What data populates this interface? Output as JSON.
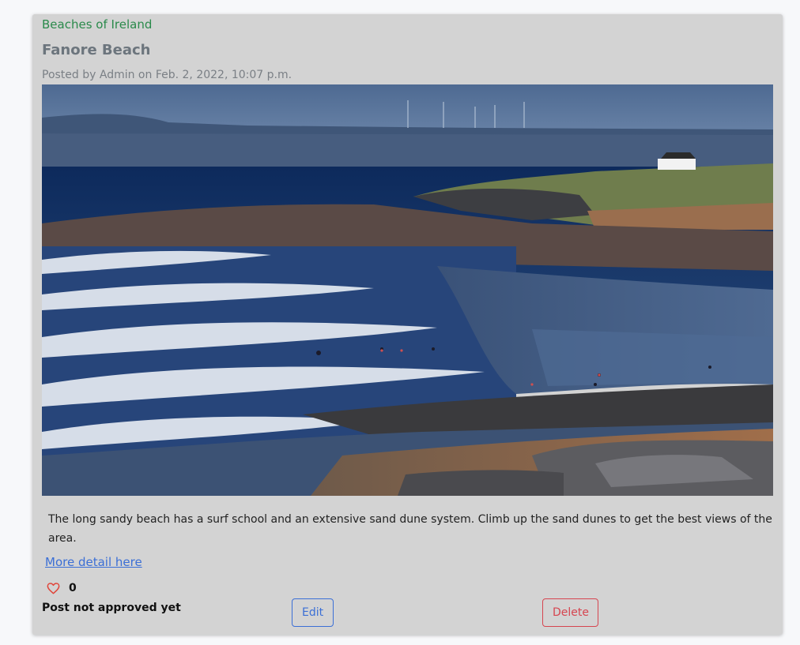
{
  "post": {
    "category": "Beaches of Ireland",
    "title": "Fanore Beach",
    "meta": "Posted by Admin on Feb. 2, 2022, 10:07 p.m.",
    "image_alt": "Fanore Beach",
    "excerpt": "The long sandy beach has a surf school and an extensive sand dune system. Climb up the sand dunes to get the best views of the area.",
    "more_link": "More detail here",
    "like_icon": "heart-outline-icon",
    "like_count": "0",
    "status": "Post not approved yet"
  },
  "actions": {
    "edit_label": "Edit",
    "delete_label": "Delete"
  },
  "colors": {
    "card_bg": "#d3d3d3",
    "category": "#2a8a4b",
    "title": "#6c757d",
    "link": "#3b6fd6",
    "danger": "#d64550",
    "heart": "#e0453a"
  }
}
